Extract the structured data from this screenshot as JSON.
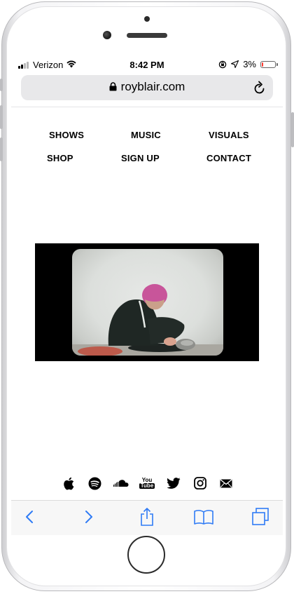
{
  "status_bar": {
    "carrier": "Verizon",
    "time": "8:42 PM",
    "battery": "3%",
    "battery_level": 0.03,
    "battery_color": "#ff3b30"
  },
  "browser": {
    "url": "royblair.com"
  },
  "nav": {
    "items": [
      "SHOWS",
      "MUSIC",
      "VISUALS",
      "SHOP",
      "SIGN UP",
      "CONTACT"
    ]
  },
  "video": {
    "thumbnail": "person with pink hair kneeling"
  },
  "social_icons": [
    "apple-music-icon",
    "spotify-icon",
    "soundcloud-icon",
    "youtube-icon",
    "twitter-icon",
    "instagram-icon",
    "email-icon"
  ],
  "youtube_text": {
    "line1": "You",
    "line2": "Tube"
  },
  "toolbar": {
    "icons": [
      "back-icon",
      "forward-icon",
      "share-icon",
      "bookmarks-icon",
      "tabs-icon"
    ],
    "accent": "#2f7bf5"
  }
}
